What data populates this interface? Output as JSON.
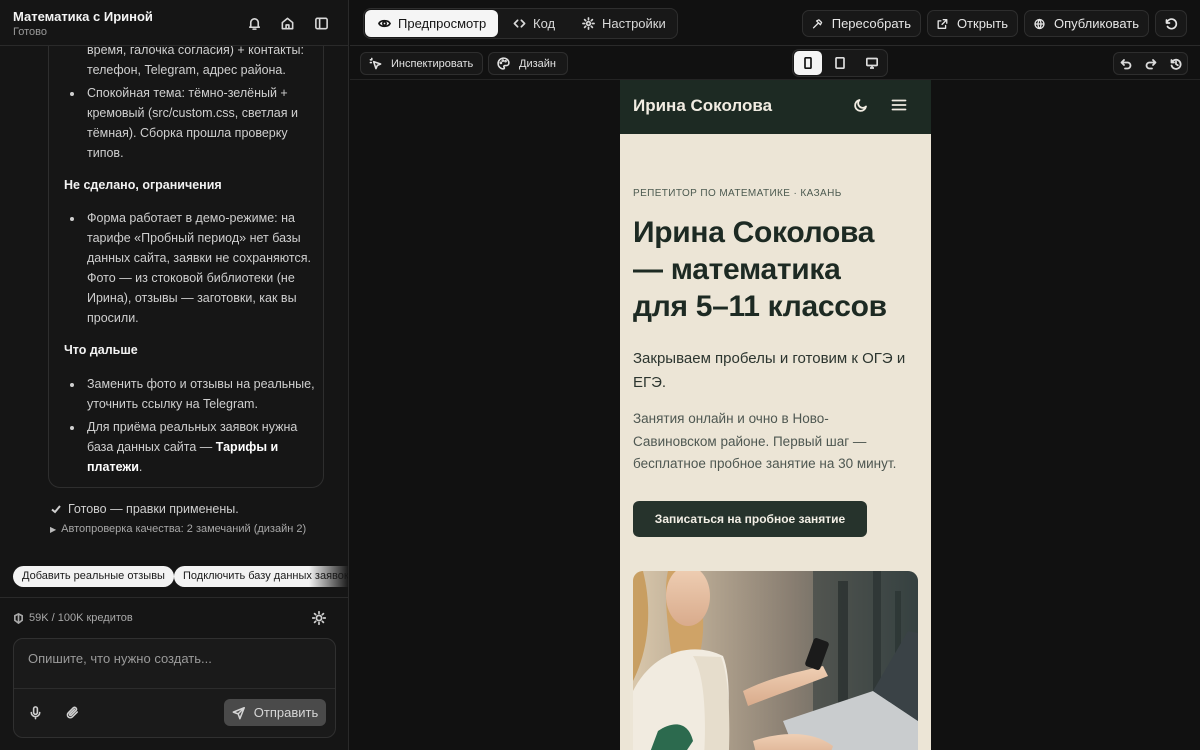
{
  "project": {
    "title": "Математика с Ириной",
    "status": "Готово"
  },
  "chat": {
    "summary_lines_1": [
      "время, галочка согласия) + контакты:",
      "телефон, Telegram, адрес района."
    ],
    "bullet_theme": [
      "Спокойная тема: тёмно-зелёный +",
      "кремовый (src/custom.css, светлая и",
      "тёмная). Сборка прошла проверку",
      "типов."
    ],
    "section_limits": "Не сделано, ограничения",
    "bullet_form": [
      "Форма работает в демо-режиме: на",
      "тарифе «Пробный период» нет базы",
      "данных сайта, заявки не сохраняются.",
      "Фото — из стоковой библиотеки (не",
      "Ирина), отзывы — заготовки, как вы",
      "просили."
    ],
    "section_next": "Что дальше",
    "bullet_replace": [
      "Заменить фото и отзывы на реальные,",
      "уточнить ссылку на Telegram."
    ],
    "bullet_db_prefix": "Для приёма реальных заявок нужна",
    "bullet_db_line2": "база данных сайта — ",
    "bullet_db_link1": "Тарифы и",
    "bullet_db_link2": "платежи",
    "bullet_db_end": ".",
    "done": "Готово — правки применены.",
    "qa": "Автопроверка качества: 2 замечаний (дизайн 2)",
    "suggestions": [
      "Добавить реальные отзывы",
      "Подключить базу данных заявок"
    ],
    "credits": "59K / 100K кредитов",
    "composer_placeholder": "Опишите, что нужно создать...",
    "send": "Отправить"
  },
  "toolbar": {
    "tab_preview": "Предпросмотр",
    "tab_code": "Код",
    "tab_settings": "Настройки",
    "rebuild": "Пересобрать",
    "open": "Открыть",
    "publish": "Опубликовать",
    "inspect": "Инспектировать",
    "design": "Дизайн"
  },
  "site": {
    "brand": "Ирина Соколова",
    "eyebrow": "РЕПЕТИТОР ПО МАТЕМАТИКЕ · КАЗАНЬ",
    "title_lines": [
      "Ирина Соколова",
      "— математика",
      "для 5–11 классов"
    ],
    "lead_lines": [
      "Закрываем пробелы и готовим к ОГЭ и",
      "ЕГЭ."
    ],
    "body_lines": [
      "Занятия онлайн и очно в Ново-",
      "Савиновском районе. Первый шаг —",
      "бесплатное пробное занятие на 30 минут."
    ],
    "cta": "Записаться на пробное занятие"
  },
  "colors": {
    "site_nav": "#1d2a23",
    "site_bg": "#ece5d6",
    "site_cta": "#26332c",
    "app_bg": "#111111"
  },
  "icons": {
    "header": [
      "bell-icon",
      "home-icon",
      "sidebar-toggle-icon"
    ],
    "tabs": [
      "eye-icon",
      "code-icon",
      "gear-icon"
    ],
    "actions": [
      "hammer-icon",
      "external-link-icon",
      "globe-icon",
      "reset-icon"
    ],
    "devices": [
      "phone-icon",
      "tablet-icon",
      "desktop-icon"
    ],
    "history": [
      "undo-icon",
      "redo-icon",
      "history-icon"
    ]
  }
}
